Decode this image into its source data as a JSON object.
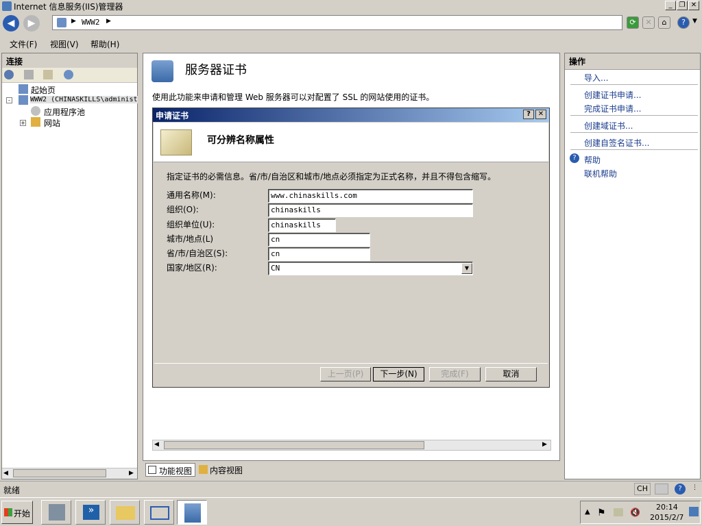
{
  "window": {
    "title": "Internet 信息服务(IIS)管理器"
  },
  "address": {
    "crumb": "WWW2",
    "sep": "▶"
  },
  "menu": {
    "file": "文件(F)",
    "view": "视图(V)",
    "help": "帮助(H)"
  },
  "connections": {
    "header": "连接",
    "tree": [
      {
        "label": "起始页"
      },
      {
        "label": "WWW2 (CHINASKILLS\\administ"
      },
      {
        "label": "应用程序池"
      },
      {
        "label": "网站"
      }
    ]
  },
  "center": {
    "title": "服务器证书",
    "description": "使用此功能来申请和管理 Web 服务器可以对配置了 SSL 的网站使用的证书。",
    "tabs": {
      "features": "功能视图",
      "content": "内容视图"
    }
  },
  "dialog": {
    "title": "申请证书",
    "header": "可分辨名称属性",
    "instruction": "指定证书的必需信息。省/市/自治区和城市/地点必须指定为正式名称，并且不得包含缩写。",
    "fields": [
      {
        "label": "通用名称(M):",
        "value": "www.chinaskills.com"
      },
      {
        "label": "组织(O):",
        "value": "chinaskills"
      },
      {
        "label": "组织单位(U):",
        "value": "chinaskills"
      },
      {
        "label": "城市/地点(L)",
        "value": "cn"
      },
      {
        "label": "省/市/自治区(S):",
        "value": "cn"
      },
      {
        "label": "国家/地区(R):",
        "value": "CN"
      }
    ],
    "buttons": {
      "prev": "上一页(P)",
      "next": "下一步(N)",
      "finish": "完成(F)",
      "cancel": "取消"
    }
  },
  "actions": {
    "header": "操作",
    "items": [
      "导入...",
      "创建证书申请...",
      "完成证书申请...",
      "创建域证书...",
      "创建自签名证书...",
      "帮助",
      "联机帮助"
    ]
  },
  "status": {
    "text": "就绪",
    "lang": "CH"
  },
  "taskbar": {
    "start": "开始",
    "time": "20:14",
    "date": "2015/2/7"
  }
}
